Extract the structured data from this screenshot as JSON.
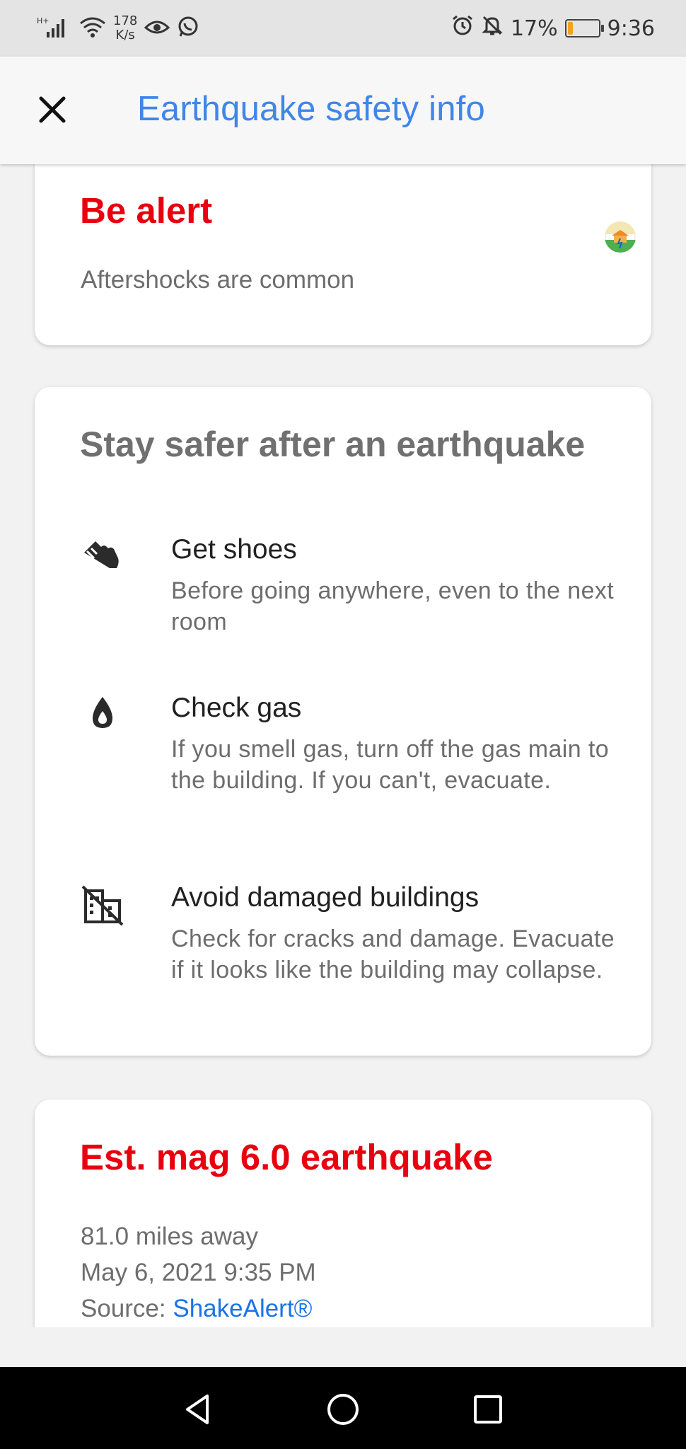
{
  "status_bar": {
    "network": "H+",
    "speed_value": "178",
    "speed_unit": "K/s",
    "battery_percent": "17%",
    "battery_level": 0.17,
    "time": "9:36",
    "icons": [
      "signal-icon",
      "wifi-icon",
      "eye-icon",
      "whatsapp-icon",
      "alarm-icon",
      "notifications-off-icon",
      "battery-icon"
    ]
  },
  "app_bar": {
    "title": "Earthquake safety info",
    "close_icon": "close-icon"
  },
  "alert_card": {
    "title": "Be alert",
    "subtitle": "Aftershocks are common",
    "badge_icon": "earthquake-alert-icon",
    "title_color": "#e8000e"
  },
  "safety_card": {
    "heading": "Stay safer after an earthquake",
    "tips": [
      {
        "icon": "shoe-icon",
        "title": "Get shoes",
        "description": "Before going anywhere, even to the next room"
      },
      {
        "icon": "gas-drop-icon",
        "title": "Check gas",
        "description": "If you smell gas, turn off the gas main to the building. If you can't, evacuate."
      },
      {
        "icon": "damaged-building-icon",
        "title": "Avoid damaged buildings",
        "description": "Check for cracks and damage. Evacuate if it looks like the building may collapse."
      }
    ]
  },
  "quake_card": {
    "title": "Est. mag 6.0 earthquake",
    "distance": "81.0 miles away",
    "datetime": "May 6, 2021 9:35 PM",
    "source_label": "Source:",
    "source_link": "ShakeAlert®"
  },
  "colors": {
    "accent_blue": "#3f86e8",
    "alert_red": "#e8000e",
    "link_blue": "#1a73e8"
  },
  "nav_bar": {
    "buttons": [
      "back-icon",
      "home-icon",
      "recents-icon"
    ]
  }
}
